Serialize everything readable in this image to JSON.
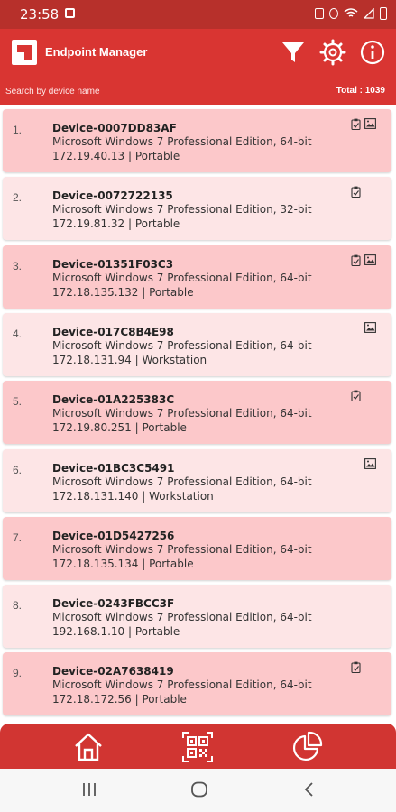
{
  "status_bar": {
    "time": "23:58"
  },
  "app_bar": {
    "title": "Endpoint Manager"
  },
  "search": {
    "placeholder": "Search by device name",
    "total": "Total : 1039"
  },
  "colors": {
    "primary": "#d93532",
    "status_bar": "#b7302b",
    "card_odd": "#fcc8ca",
    "card_even": "#fde5e6"
  },
  "devices": [
    {
      "index": "1.",
      "name": "Device-0007DD83AF",
      "os": "Microsoft Windows 7 Professional Edition, 64-bit",
      "info": "172.19.40.13 | Portable",
      "icons": [
        "clipboard-icon",
        "image-icon"
      ]
    },
    {
      "index": "2.",
      "name": "Device-0072722135",
      "os": "Microsoft Windows 7 Professional Edition, 32-bit",
      "info": "172.19.81.32 | Portable",
      "icons": [
        "clipboard-icon"
      ]
    },
    {
      "index": "3.",
      "name": "Device-01351F03C3",
      "os": "Microsoft Windows 7 Professional Edition, 64-bit",
      "info": "172.18.135.132 | Portable",
      "icons": [
        "clipboard-icon",
        "image-icon"
      ]
    },
    {
      "index": "4.",
      "name": "Device-017C8B4E98",
      "os": "Microsoft Windows 7 Professional Edition, 64-bit",
      "info": "172.18.131.94 | Workstation",
      "icons": [
        "image-icon"
      ]
    },
    {
      "index": "5.",
      "name": "Device-01A225383C",
      "os": "Microsoft Windows 7 Professional Edition, 64-bit",
      "info": "172.19.80.251 | Portable",
      "icons": [
        "clipboard-icon"
      ]
    },
    {
      "index": "6.",
      "name": "Device-01BC3C5491",
      "os": "Microsoft Windows 7 Professional Edition, 64-bit",
      "info": "172.18.131.140 | Workstation",
      "icons": [
        "image-icon"
      ]
    },
    {
      "index": "7.",
      "name": "Device-01D5427256",
      "os": "Microsoft Windows 7 Professional Edition, 64-bit",
      "info": "172.18.135.134 | Portable",
      "icons": []
    },
    {
      "index": "8.",
      "name": "Device-0243FBCC3F",
      "os": "Microsoft Windows 7 Professional Edition, 64-bit",
      "info": "192.168.1.10 | Portable",
      "icons": []
    },
    {
      "index": "9.",
      "name": "Device-02A7638419",
      "os": "Microsoft Windows 7 Professional Edition, 64-bit",
      "info": "172.18.172.56 | Portable",
      "icons": [
        "clipboard-icon"
      ]
    }
  ],
  "bottom_nav": [
    "home-icon",
    "qr-scan-icon",
    "pie-chart-icon"
  ],
  "system_nav": [
    "recents-icon",
    "home-circle-icon",
    "back-icon"
  ]
}
